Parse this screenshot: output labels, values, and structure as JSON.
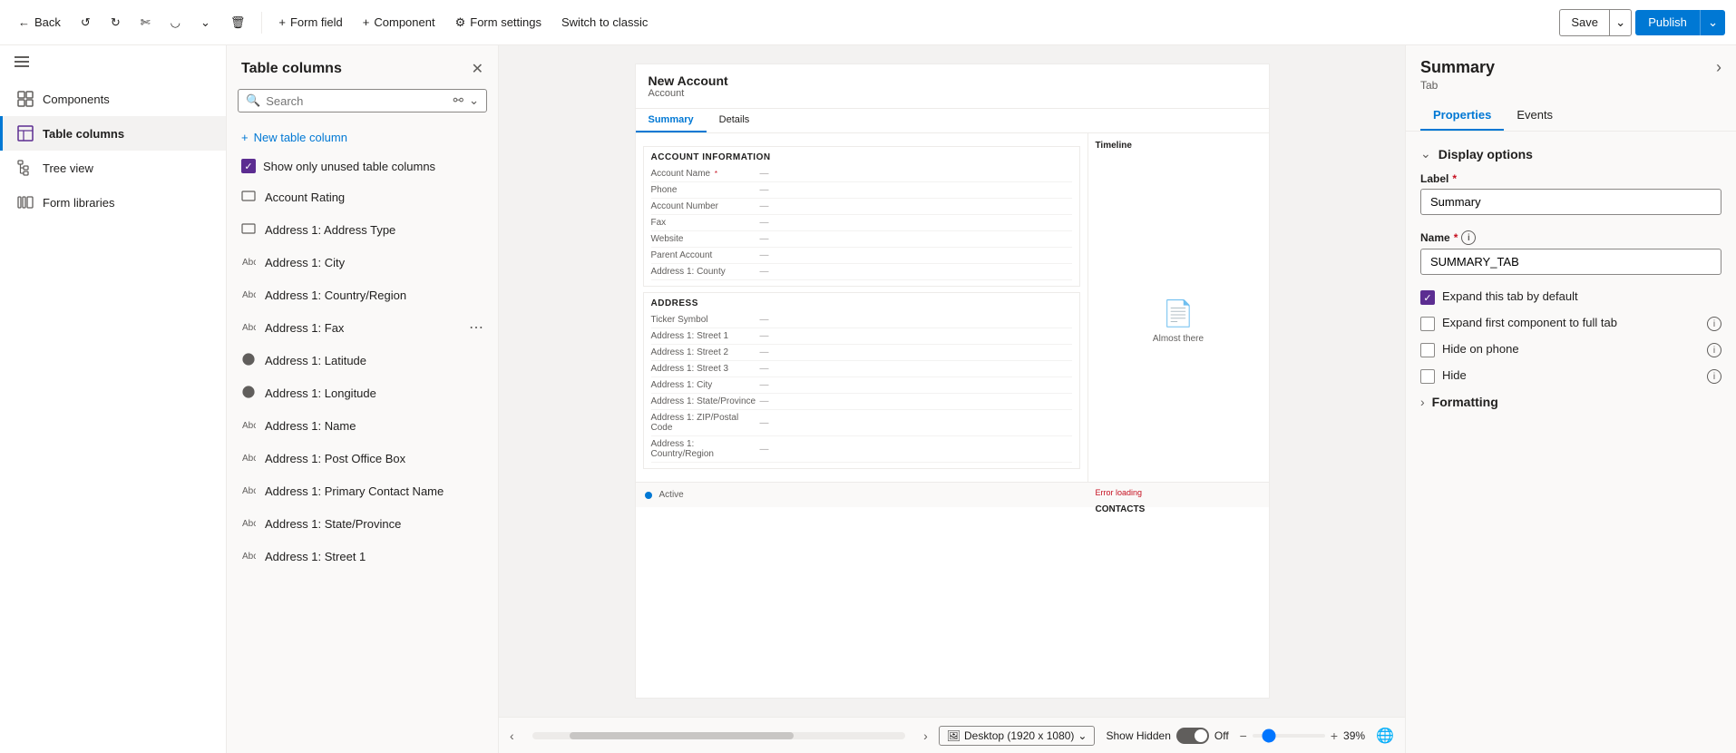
{
  "toolbar": {
    "back_label": "Back",
    "form_field_label": "Form field",
    "component_label": "Component",
    "form_settings_label": "Form settings",
    "switch_label": "Switch to classic",
    "save_label": "Save",
    "publish_label": "Publish"
  },
  "sidebar": {
    "items": [
      {
        "id": "components",
        "label": "Components",
        "icon": "grid"
      },
      {
        "id": "table-columns",
        "label": "Table columns",
        "icon": "table",
        "active": true
      },
      {
        "id": "tree-view",
        "label": "Tree view",
        "icon": "tree"
      },
      {
        "id": "form-libraries",
        "label": "Form libraries",
        "icon": "library"
      }
    ]
  },
  "table_columns_panel": {
    "title": "Table columns",
    "search_placeholder": "Search",
    "new_column_label": "New table column",
    "show_unused_label": "Show only unused table columns",
    "columns": [
      {
        "name": "Account Rating",
        "type": "option",
        "icon": "rect"
      },
      {
        "name": "Address 1: Address Type",
        "type": "option",
        "icon": "rect"
      },
      {
        "name": "Address 1: City",
        "type": "text",
        "icon": "text"
      },
      {
        "name": "Address 1: Country/Region",
        "type": "text",
        "icon": "text"
      },
      {
        "name": "Address 1: Fax",
        "type": "text",
        "icon": "text",
        "show_more": true
      },
      {
        "name": "Address 1: Latitude",
        "type": "decimal",
        "icon": "circle"
      },
      {
        "name": "Address 1: Longitude",
        "type": "decimal",
        "icon": "circle"
      },
      {
        "name": "Address 1: Name",
        "type": "text",
        "icon": "text"
      },
      {
        "name": "Address 1: Post Office Box",
        "type": "text",
        "icon": "text"
      },
      {
        "name": "Address 1: Primary Contact Name",
        "type": "text",
        "icon": "text"
      },
      {
        "name": "Address 1: State/Province",
        "type": "text",
        "icon": "text"
      },
      {
        "name": "Address 1: Street 1",
        "type": "text",
        "icon": "text"
      }
    ]
  },
  "form_preview": {
    "title": "New Account",
    "subtitle": "Account",
    "tabs": [
      "Summary",
      "Details"
    ],
    "active_tab": "Summary",
    "sections": [
      {
        "title": "ACCOUNT INFORMATION",
        "fields": [
          {
            "label": "Account Name",
            "required": true,
            "value": "—"
          },
          {
            "label": "Phone",
            "value": "—"
          },
          {
            "label": "Account Number",
            "value": "—"
          },
          {
            "label": "Fax",
            "value": "—"
          },
          {
            "label": "Website",
            "value": "—"
          },
          {
            "label": "Parent Account",
            "value": "—"
          },
          {
            "label": "Address 1: County",
            "value": "—"
          }
        ]
      },
      {
        "title": "ADDRESS",
        "fields": [
          {
            "label": "Ticker Symbol",
            "value": "—"
          },
          {
            "label": "Address 1: Street 1",
            "value": "—"
          },
          {
            "label": "Address 1: Street 2",
            "value": "—"
          },
          {
            "label": "Address 1: Street 3",
            "value": "—"
          },
          {
            "label": "Address 1: City",
            "value": "—"
          },
          {
            "label": "Address 1: State/Province",
            "value": "—"
          },
          {
            "label": "Address 1: ZIP/Postal Code",
            "value": "—"
          },
          {
            "label": "Address 1: Country/Region",
            "value": "—"
          }
        ]
      }
    ],
    "timeline_label": "Timeline",
    "timeline_placeholder": "Almost there",
    "contacts_label": "CONTACTS",
    "error_loading": "Error loading",
    "status": "Active"
  },
  "canvas_bottom": {
    "desktop_label": "Desktop (1920 x 1080)",
    "show_hidden_label": "Show Hidden",
    "toggle_state": "Off",
    "zoom_label": "39%"
  },
  "right_panel": {
    "title": "Summary",
    "subtitle": "Tab",
    "tabs": [
      "Properties",
      "Events"
    ],
    "active_tab": "Properties",
    "display_options": {
      "title": "Display options",
      "label_field": {
        "label": "Label",
        "required": true,
        "value": "Summary"
      },
      "name_field": {
        "label": "Name",
        "required": true,
        "value": "SUMMARY_TAB"
      },
      "checkboxes": [
        {
          "id": "expand-tab",
          "label": "Expand this tab by default",
          "checked": true,
          "has_info": false
        },
        {
          "id": "expand-component",
          "label": "Expand first component to full tab",
          "checked": false,
          "has_info": true
        },
        {
          "id": "hide-on-phone",
          "label": "Hide on phone",
          "checked": false,
          "has_info": true
        },
        {
          "id": "hide",
          "label": "Hide",
          "checked": false,
          "has_info": true
        }
      ]
    },
    "formatting": {
      "title": "Formatting"
    }
  }
}
